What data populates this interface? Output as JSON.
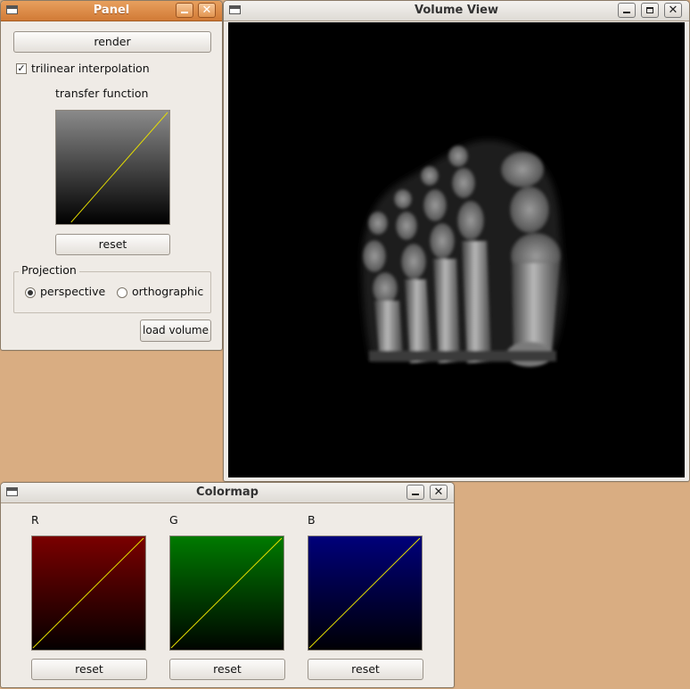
{
  "panel": {
    "title": "Panel",
    "render_label": "render",
    "trilinear_label": "trilinear interpolation",
    "trilinear_checked": true,
    "check_glyph": "✓",
    "transfer_function_label": "transfer function",
    "reset_label": "reset",
    "projection": {
      "title": "Projection",
      "options": [
        {
          "label": "perspective",
          "selected": true
        },
        {
          "label": "orthographic",
          "selected": false
        }
      ]
    },
    "load_volume_label": "load volume"
  },
  "volume_view": {
    "title": "Volume View",
    "background": "#000000",
    "content_icon": "foot-xray-volume-render"
  },
  "colormap": {
    "title": "Colormap",
    "channels": [
      {
        "label": "R",
        "color": "#7a0000",
        "reset_label": "reset"
      },
      {
        "label": "G",
        "color": "#007a00",
        "reset_label": "reset"
      },
      {
        "label": "B",
        "color": "#00007a",
        "reset_label": "reset"
      }
    ]
  },
  "window_buttons": {
    "minimize": "minimize-icon",
    "maximize": "maximize-icon",
    "close": "close-icon",
    "close_glyph": "✕"
  },
  "colors": {
    "desktop": "#d9ad82",
    "active_titlebar": "#d17a36",
    "transfer_line": "#e8e000"
  }
}
